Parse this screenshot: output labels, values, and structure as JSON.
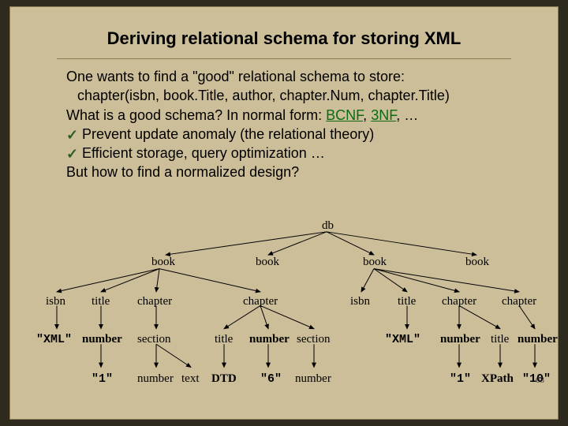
{
  "slide": {
    "title": "Deriving relational schema for storing XML",
    "lines": {
      "l1": "One wants to find a \"good\" relational schema to store:",
      "l2": "chapter(isbn, book.Title, author, chapter.Num, chapter.Title)",
      "l3a": "What is a good schema? In normal form: ",
      "l3b": "BCNF",
      "l3c": ", ",
      "l3d": "3NF",
      "l3e": ", …",
      "l4": "Prevent update anomaly (the relational theory)",
      "l5": "Efficient storage, query optimization …",
      "l6": "But how to find a normalized design?"
    },
    "diagram": {
      "db": "db",
      "book": "book",
      "isbn": "isbn",
      "title": "title",
      "chapter": "chapter",
      "xml": "\"XML\"",
      "number": "number",
      "section": "section",
      "one": "\"1\"",
      "text": "text",
      "dtd": "DTD",
      "six": "\"6\"",
      "xpath": "XPath",
      "ten": "\"10\""
    },
    "slidenum": "63"
  }
}
